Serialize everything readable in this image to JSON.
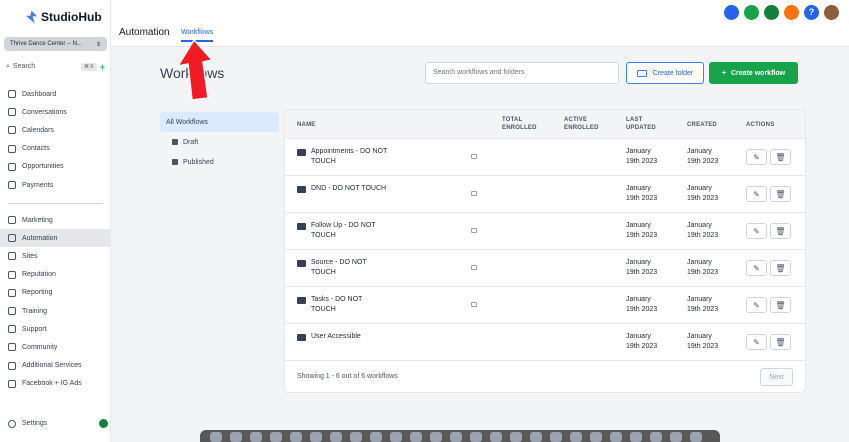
{
  "app": {
    "name": "StudioHub",
    "account": "Thrive Dance Center -- N..."
  },
  "sidebar": {
    "search_label": "Search",
    "search_shortcut": "⌘ K",
    "items": [
      {
        "label": "Dashboard",
        "icon": "dashboard-icon"
      },
      {
        "label": "Conversations",
        "icon": "chat-icon"
      },
      {
        "label": "Calendars",
        "icon": "calendar-icon"
      },
      {
        "label": "Contacts",
        "icon": "contacts-icon"
      },
      {
        "label": "Opportunities",
        "icon": "opportunities-icon"
      },
      {
        "label": "Payments",
        "icon": "payments-icon"
      },
      {
        "label": "Marketing",
        "icon": "marketing-icon"
      },
      {
        "label": "Automation",
        "icon": "automation-icon"
      },
      {
        "label": "Sites",
        "icon": "sites-icon"
      },
      {
        "label": "Reputation",
        "icon": "star-icon"
      },
      {
        "label": "Reporting",
        "icon": "reporting-icon"
      },
      {
        "label": "Training",
        "icon": "training-icon"
      },
      {
        "label": "Support",
        "icon": "support-icon"
      },
      {
        "label": "Community",
        "icon": "community-icon"
      },
      {
        "label": "Additional Services",
        "icon": "services-icon"
      },
      {
        "label": "Facebook + IG Ads",
        "icon": "facebook-icon"
      }
    ],
    "active_item": "Automation",
    "settings_label": "Settings"
  },
  "header": {
    "title": "Automation",
    "tab": "Workflows",
    "icon_colors": [
      "#2563eb",
      "#16a34a",
      "#15803d",
      "#f97316",
      "#2563eb"
    ]
  },
  "main": {
    "page_title": "Workflows",
    "search_placeholder": "Search workflows and folders",
    "create_folder_label": "Create folder",
    "create_workflow_label": "Create workflow",
    "filters": [
      {
        "label": "All Workflows"
      },
      {
        "label": "Draft"
      },
      {
        "label": "Published"
      }
    ],
    "columns": {
      "name": "NAME",
      "total_line1": "TOTAL",
      "total_line2": "ENROLLED",
      "active_line1": "ACTIVE",
      "active_line2": "ENROLLED",
      "updated_line1": "LAST",
      "updated_line2": "UPDATED",
      "created": "CREATED",
      "actions": "ACTIONS"
    },
    "rows": [
      {
        "line1": "Appointments - DO NOT",
        "line2": "TOUCH",
        "upd1": "January",
        "upd2": "19th 2023",
        "crt1": "January",
        "crt2": "19th 2023"
      },
      {
        "line1": "DND - DO NOT TOUCH",
        "line2": "",
        "upd1": "January",
        "upd2": "19th 2023",
        "crt1": "January",
        "crt2": "19th 2023"
      },
      {
        "line1": "Follow Up - DO NOT",
        "line2": "TOUCH",
        "upd1": "January",
        "upd2": "19th 2023",
        "crt1": "January",
        "crt2": "19th 2023"
      },
      {
        "line1": "Source - DO NOT",
        "line2": "TOUCH",
        "upd1": "January",
        "upd2": "19th 2023",
        "crt1": "January",
        "crt2": "19th 2023"
      },
      {
        "line1": "Tasks - DO NOT",
        "line2": "TOUCH",
        "upd1": "January",
        "upd2": "19th 2023",
        "crt1": "January",
        "crt2": "19th 2023"
      },
      {
        "line1": "User Accessible",
        "line2": "",
        "upd1": "January",
        "upd2": "19th 2023",
        "crt1": "January",
        "crt2": "19th 2023"
      }
    ],
    "showing_text": "Showing 1 - 6 out of 6 workflows",
    "next_label": "Next"
  },
  "colors": {
    "accent": "#2563eb",
    "primary_button": "#16a34a",
    "annotation_arrow": "#ef1c24"
  }
}
